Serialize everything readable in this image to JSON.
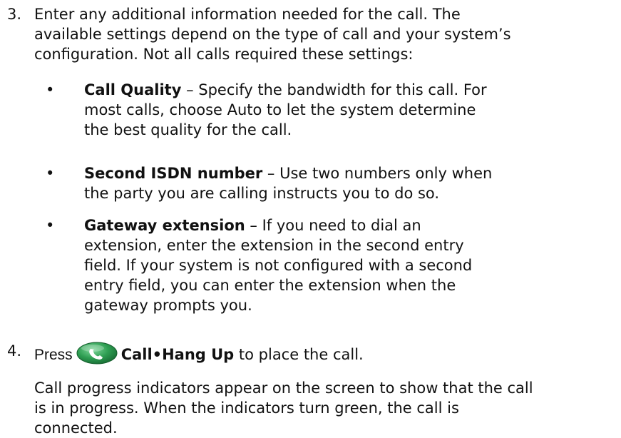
{
  "step3": {
    "number": "3.",
    "text": "Enter any additional information needed for the call. The\navailable settings depend on the type of call and your system’s\nconfiguration. Not all calls required these settings:"
  },
  "bullets": [
    {
      "marker": "•",
      "term": "Call Quality",
      "desc": " – Specify the bandwidth for this call. For\nmost calls, choose Auto to let the system determine\nthe best quality for the call."
    },
    {
      "marker": "•",
      "term": "Second ISDN number",
      "desc": " – Use two numbers only when\nthe party you are calling instructs you to do so."
    },
    {
      "marker": "•",
      "term": "Gateway extension",
      "desc": " – If you need to dial an\nextension, enter the extension in the second entry\nfield. If your system is not configured with a second\nentry field, you can enter the extension when the\ngateway prompts you."
    }
  ],
  "step4": {
    "number": "4.",
    "press": "Press",
    "icon": "phone-handset-icon",
    "button_label": "Call•Hang Up",
    "rest": " to place the call.",
    "note": "Call progress indicators appear on the screen to show that the call\nis in progress. When the indicators turn green, the call is\nconnected.",
    "icon_color": "#2e9e52"
  }
}
